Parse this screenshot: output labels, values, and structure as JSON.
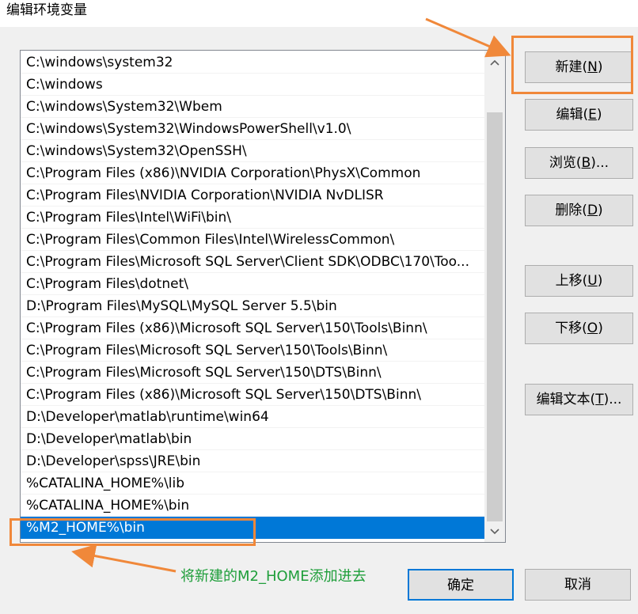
{
  "window": {
    "title": "编辑环境变量"
  },
  "path_list": {
    "items": [
      "C:\\windows\\system32",
      "C:\\windows",
      "C:\\windows\\System32\\Wbem",
      "C:\\windows\\System32\\WindowsPowerShell\\v1.0\\",
      "C:\\windows\\System32\\OpenSSH\\",
      "C:\\Program Files (x86)\\NVIDIA Corporation\\PhysX\\Common",
      "C:\\Program Files\\NVIDIA Corporation\\NVIDIA NvDLISR",
      "C:\\Program Files\\Intel\\WiFi\\bin\\",
      "C:\\Program Files\\Common Files\\Intel\\WirelessCommon\\",
      "C:\\Program Files\\Microsoft SQL Server\\Client SDK\\ODBC\\170\\Too...",
      "C:\\Program Files\\dotnet\\",
      "D:\\Program Files\\MySQL\\MySQL Server 5.5\\bin",
      "C:\\Program Files (x86)\\Microsoft SQL Server\\150\\Tools\\Binn\\",
      "C:\\Program Files\\Microsoft SQL Server\\150\\Tools\\Binn\\",
      "C:\\Program Files\\Microsoft SQL Server\\150\\DTS\\Binn\\",
      "C:\\Program Files (x86)\\Microsoft SQL Server\\150\\DTS\\Binn\\",
      "D:\\Developer\\matlab\\runtime\\win64",
      "D:\\Developer\\matlab\\bin",
      "D:\\Developer\\spss\\JRE\\bin",
      "%CATALINA_HOME%\\lib",
      "%CATALINA_HOME%\\bin",
      "%M2_HOME%\\bin"
    ],
    "selected_index": 21,
    "selected_color": "#0078d7"
  },
  "buttons": {
    "new": {
      "text": "新建(",
      "key": "N",
      "end": ")"
    },
    "edit": {
      "text": "编辑(",
      "key": "E",
      "end": ")"
    },
    "browse": {
      "text": "浏览(",
      "key": "B",
      "end": ")..."
    },
    "delete": {
      "text": "删除(",
      "key": "D",
      "end": ")"
    },
    "up": {
      "text": "上移(",
      "key": "U",
      "end": ")"
    },
    "down": {
      "text": "下移(",
      "key": "O",
      "end": ")"
    },
    "edit_text": {
      "text": "编辑文本(",
      "key": "T",
      "end": ")..."
    },
    "ok": "确定",
    "cancel": "取消"
  },
  "annotation": {
    "text": "将新建的M2_HOME添加进去",
    "text_color": "#1e9e3a",
    "highlight_color": "#f0883a"
  },
  "icons": {
    "scroll_up": "chevron-up-icon",
    "scroll_down": "chevron-down-icon"
  }
}
